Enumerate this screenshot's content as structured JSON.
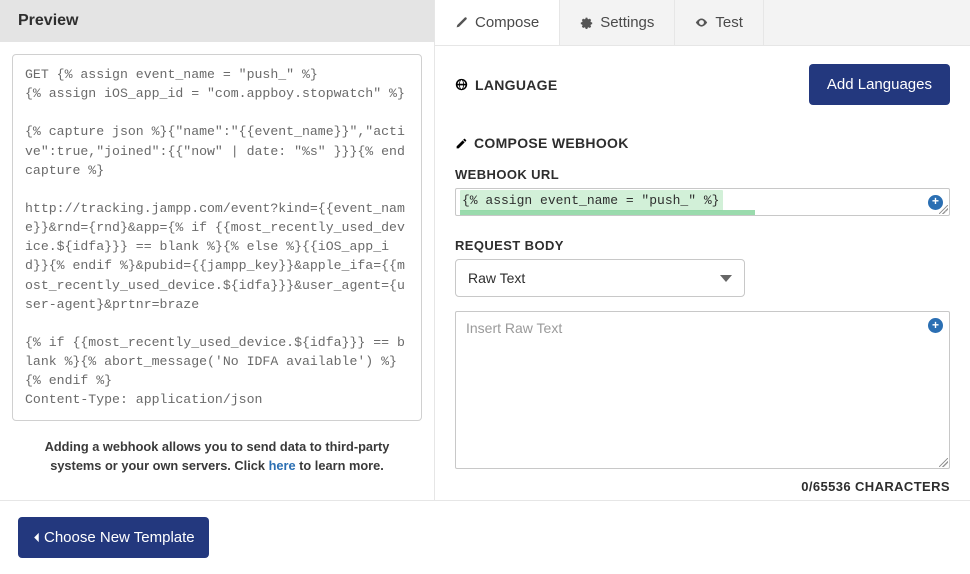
{
  "preview": {
    "title": "Preview",
    "code": "GET {% assign event_name = \"push_\" %}\n{% assign iOS_app_id = \"com.appboy.stopwatch\" %}\n\n{% capture json %}{\"name\":\"{{event_name}}\",\"active\":true,\"joined\":{{\"now\" | date: \"%s\" }}}{% endcapture %}\n\nhttp://tracking.jampp.com/event?kind={{event_name}}&rnd={rnd}&app={% if {{most_recently_used_device.${idfa}}} == blank %}{% else %}{{iOS_app_id}}{% endif %}&pubid={{jampp_key}}&apple_ifa={{most_recently_used_device.${idfa}}}&user_agent={user-agent}&prtnr=braze\n\n{% if {{most_recently_used_device.${idfa}}} == blank %}{% abort_message('No IDFA available') %}\n{% endif %}\nContent-Type: application/json",
    "footer_prefix": "Adding a webhook allows you to send data to third-party systems or your own servers. Click ",
    "footer_link": "here",
    "footer_suffix": " to learn more."
  },
  "tabs": {
    "compose": "Compose",
    "settings": "Settings",
    "test": "Test"
  },
  "language": {
    "label": "LANGUAGE",
    "button": "Add Languages"
  },
  "compose": {
    "title": "COMPOSE WEBHOOK",
    "url_label": "WEBHOOK URL",
    "url_value": "{% assign event_name = \"push_\" %}",
    "body_label": "REQUEST BODY",
    "body_type": "Raw Text",
    "raw_placeholder": "Insert Raw Text",
    "char_count": "0/65536 CHARACTERS"
  },
  "footer": {
    "choose_template": "Choose New Template"
  }
}
